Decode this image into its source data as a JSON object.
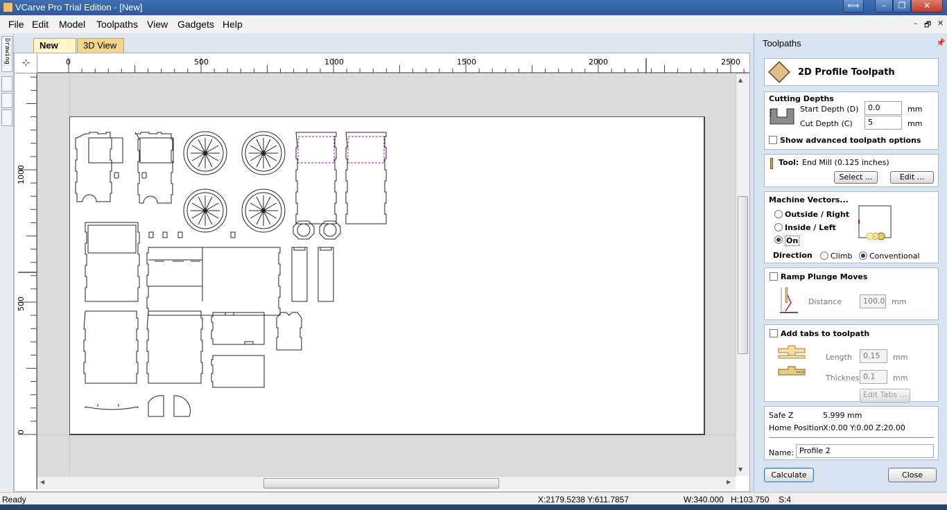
{
  "window": {
    "title": "VCarve Pro Trial Edition - [New]",
    "controls": {
      "swap": "⟺",
      "minimize": "–",
      "restore": "❐",
      "close": "✕"
    }
  },
  "menu": {
    "items": [
      "File",
      "Edit",
      "Model",
      "Toolpaths",
      "View",
      "Gadgets",
      "Help"
    ],
    "mdi_controls": {
      "minimize": "–",
      "restore": "🗗",
      "close": "✕"
    }
  },
  "left_tab": {
    "label": "Drawing"
  },
  "doc_tabs": [
    {
      "label": "New",
      "active": true
    },
    {
      "label": "3D View",
      "active": false
    }
  ],
  "rulers": {
    "horizontal": [
      "0",
      "500",
      "1000",
      "1500",
      "2000",
      "2500"
    ],
    "vertical": [
      "1000",
      "500",
      "0"
    ]
  },
  "toolpath_panel": {
    "header": "Toolpaths",
    "title": "2D Profile Toolpath",
    "cutting_depths": {
      "heading": "Cutting Depths",
      "start_depth_label": "Start Depth (D)",
      "start_depth_value": "0.0",
      "start_depth_unit": "mm",
      "cut_depth_label": "Cut Depth (C)",
      "cut_depth_value": "5",
      "cut_depth_unit": "mm"
    },
    "advanced": {
      "label": "Show advanced toolpath options",
      "checked": false
    },
    "tool": {
      "label": "Tool:",
      "value": "End Mill (0.125 inches)",
      "select_button": "Select ...",
      "edit_button": "Edit ..."
    },
    "machine_vectors": {
      "heading": "Machine Vectors...",
      "options": [
        "Outside / Right",
        "Inside / Left",
        "On"
      ],
      "selected": "On",
      "direction_label": "Direction",
      "direction_options": [
        "Climb",
        "Conventional"
      ],
      "direction_selected": "Conventional"
    },
    "ramp": {
      "label": "Ramp Plunge Moves",
      "checked": false,
      "distance_label": "Distance",
      "distance_value": "100.0",
      "distance_unit": "mm"
    },
    "tabs": {
      "label": "Add tabs to toolpath",
      "checked": false,
      "length_label": "Length",
      "length_value": "0.15",
      "length_unit": "mm",
      "thickness_label": "Thickness",
      "thickness_value": "0.1",
      "thickness_unit": "mm",
      "edit_button": "Edit Tabs ..."
    },
    "info": {
      "safe_z_label": "Safe Z",
      "safe_z_value": "5.999 mm",
      "home_label": "Home Position",
      "home_value": "X:0.00 Y:0.00 Z:20.00",
      "name_label": "Name:",
      "name_value": "Profile 2"
    },
    "calculate_button": "Calculate",
    "close_button": "Close"
  },
  "status_bar": {
    "state": "Ready",
    "coords": "X:2179.5238 Y:611.7857",
    "width": "W:340.000",
    "height": "H:103.750",
    "selection": "S:4"
  },
  "colors": {
    "title_bar": "#2c5aa0",
    "active_tab": "#fff6c8",
    "inactive_tab": "#f3d68a",
    "panel_bg": "#d8e4f2",
    "selected_vector": "#c000c0"
  }
}
